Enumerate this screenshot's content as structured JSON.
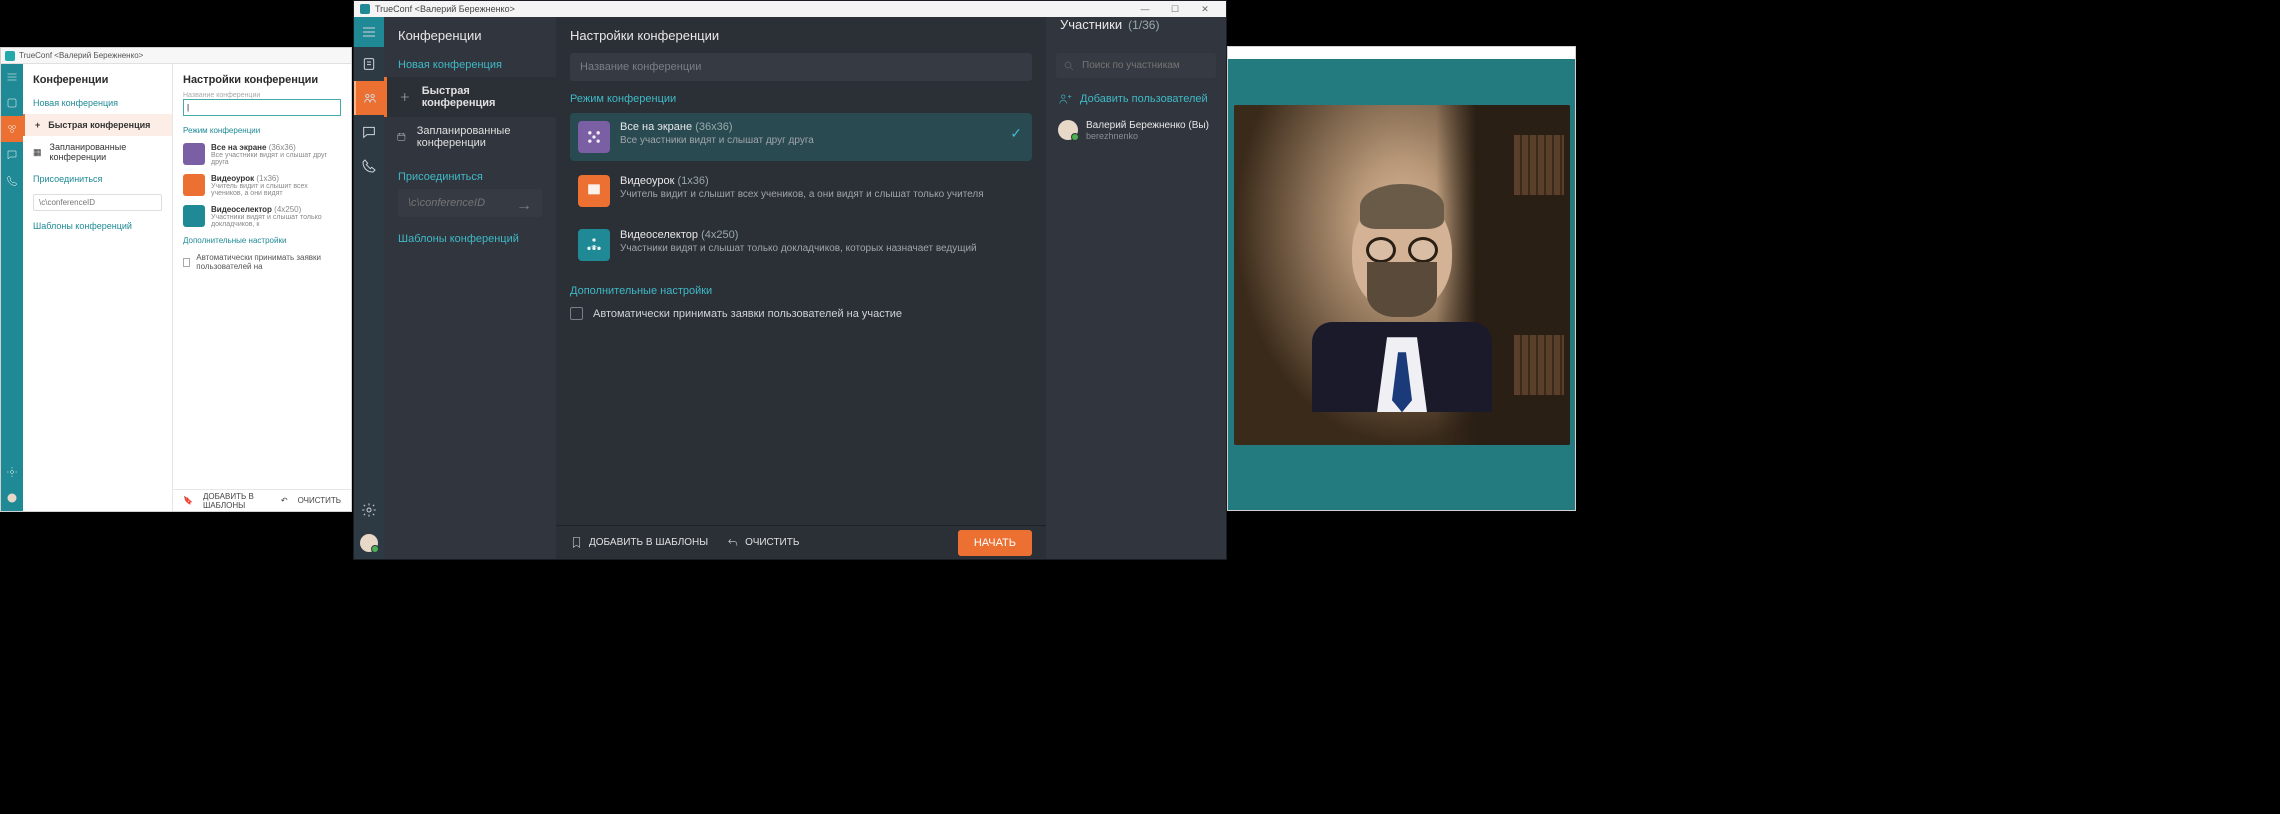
{
  "windowTitle": "TrueConf <Валерий Бережненко>",
  "winSmall": {
    "title": "TrueConf <Валерий Бережненко>",
    "col1": {
      "header": "Конференции",
      "newConf": "Новая конференция",
      "quick": "Быстрая конференция",
      "scheduled": "Запланированные конференции",
      "join": "Присоединиться",
      "joinPlaceholder": "\\c\\conferenceID",
      "templates": "Шаблоны конференций"
    },
    "col2": {
      "header": "Настройки конференции",
      "nameLabel": "Название конференции",
      "modeHeader": "Режим конференции",
      "modes": [
        {
          "title": "Все на экране",
          "size": "(36x36)",
          "desc": "Все участники видят и слышат друг друга"
        },
        {
          "title": "Видеоурок",
          "size": "(1x36)",
          "desc": "Учитель видит и слышит всех учеников, а они видят"
        },
        {
          "title": "Видеоселектор",
          "size": "(4x250)",
          "desc": "Участники видят и слышат только докладчиков, к"
        }
      ],
      "addSettings": "Дополнительные настройки",
      "autoAccept": "Автоматически принимать заявки пользователей на",
      "addTpl": "ДОБАВИТЬ В ШАБЛОНЫ",
      "clear": "ОЧИСТИТЬ"
    }
  },
  "winMain": {
    "colA": {
      "header": "Конференции",
      "newConf": "Новая конференция",
      "quick": "Быстрая конференция",
      "scheduled": "Запланированные конференции",
      "join": "Присоединиться",
      "joinPlaceholder": "\\c\\conferenceID",
      "templates": "Шаблоны конференций"
    },
    "colB": {
      "header": "Настройки конференции",
      "namePlaceholder": "Название конференции",
      "modeHeader": "Режим конференции",
      "modes": [
        {
          "title": "Все на экране",
          "size": "(36x36)",
          "desc": "Все участники видят и слышат друг друга"
        },
        {
          "title": "Видеоурок",
          "size": "(1x36)",
          "desc": "Учитель видит и слышит всех учеников, а они видят и слышат только учителя"
        },
        {
          "title": "Видеоселектор",
          "size": "(4x250)",
          "desc": "Участники видят и слышат только докладчиков, которых назначает ведущий"
        }
      ],
      "addSettings": "Дополнительные настройки",
      "autoAccept": "Автоматически принимать заявки пользователей на участие",
      "addTpl": "ДОБАВИТЬ В ШАБЛОНЫ",
      "clear": "ОЧИСТИТЬ",
      "start": "НАЧАТЬ"
    },
    "colC": {
      "header": "Участники",
      "count": "(1/36)",
      "searchPlaceholder": "Поиск по участникам",
      "addUsers": "Добавить пользователей",
      "user": {
        "name": "Валерий Бережненко (Вы)",
        "id": "berezhnenko"
      }
    }
  }
}
